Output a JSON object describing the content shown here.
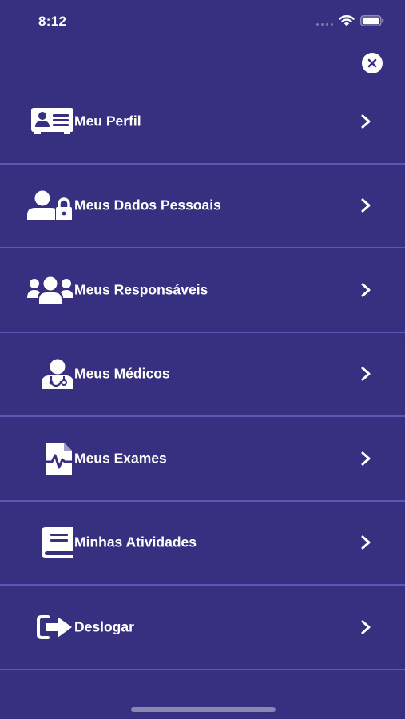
{
  "status_bar": {
    "time": "8:12"
  },
  "menu": {
    "items": [
      {
        "id": "meu-perfil",
        "label": "Meu Perfil",
        "icon": "profile-card-icon"
      },
      {
        "id": "meus-dados-pessoais",
        "label": "Meus Dados Pessoais",
        "icon": "user-lock-icon"
      },
      {
        "id": "meus-responsaveis",
        "label": "Meus Responsáveis",
        "icon": "users-group-icon"
      },
      {
        "id": "meus-medicos",
        "label": "Meus Médicos",
        "icon": "doctor-icon"
      },
      {
        "id": "meus-exames",
        "label": "Meus Exames",
        "icon": "medical-file-icon"
      },
      {
        "id": "minhas-atividades",
        "label": "Minhas Atividades",
        "icon": "book-icon"
      },
      {
        "id": "deslogar",
        "label": "Deslogar",
        "icon": "sign-out-icon"
      }
    ]
  },
  "colors": {
    "background": "#372f80",
    "divider": "#5e57b5",
    "text": "#ffffff"
  }
}
